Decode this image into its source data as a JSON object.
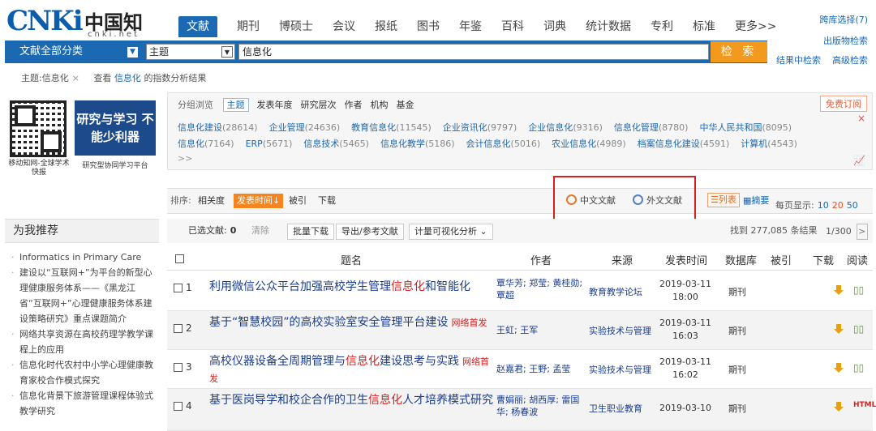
{
  "logo": {
    "cn": "CNKi",
    "zh": "中国知网",
    "sub": "cnki.net"
  },
  "top_nav": {
    "tabs": [
      "文献",
      "期刊",
      "博硕士",
      "会议",
      "报纸",
      "图书",
      "年鉴",
      "百科",
      "词典",
      "统计数据",
      "专利",
      "标准",
      "更多>>"
    ],
    "active": 0
  },
  "right_links": {
    "cross_library": "跨库选择(7)",
    "publication_search": "出版物检索",
    "result_search": "结果中检索",
    "advanced_search": "高级检索"
  },
  "search": {
    "category": "文献全部分类",
    "field": "主题",
    "query": "信息化",
    "button": "检 索"
  },
  "breadcrumb": {
    "filter": "主题:信息化",
    "remove": "×",
    "view_prefix": "查看",
    "view_term": "信息化",
    "view_suffix": "的指数分析结果"
  },
  "sidebar": {
    "qr_caption": "移动知网-全球学术快报",
    "promo_text": "研究与学习 不能少利器",
    "promo_caption": "研究型协同学习平台",
    "recommend_title": "为我推荐",
    "recommend_items": [
      "Informatics in Primary Care",
      "建设以“互联网+”为平台的新型心理健康服务体系——《黑龙江省“互联网+”心理健康服务体系建设策略研究》重点课题简介",
      "网络共享资源在高校药理学教学课程上的应用",
      "信息化时代农村中小学心理健康教育家校合作模式探究",
      "信息化背景下旅游管理课程体验式教学研究"
    ]
  },
  "group": {
    "label": "分组浏览",
    "tabs": [
      "主题",
      "发表年度",
      "研究层次",
      "作者",
      "机构",
      "基金"
    ],
    "subscribe": "免费订阅",
    "close": "×",
    "row1": [
      {
        "n": "信息化建设",
        "c": "(28614)"
      },
      {
        "n": "企业管理",
        "c": "(24636)"
      },
      {
        "n": "教育信息化",
        "c": "(11545)"
      },
      {
        "n": "企业资讯化",
        "c": "(9797)"
      },
      {
        "n": "企业信息化",
        "c": "(9316)"
      },
      {
        "n": "信息化管理",
        "c": "(8780)"
      },
      {
        "n": "中华人民共和国",
        "c": "(8095)"
      }
    ],
    "row2": [
      {
        "n": "信息化",
        "c": "(7164)"
      },
      {
        "n": "ERP",
        "c": "(5671)"
      },
      {
        "n": "信息技术",
        "c": "(5465)"
      },
      {
        "n": "信息化教学",
        "c": "(5186)"
      },
      {
        "n": "会计信息化",
        "c": "(5016)"
      },
      {
        "n": "农业信息化",
        "c": "(4989)"
      },
      {
        "n": "档案信息化建设",
        "c": "(4591)"
      },
      {
        "n": "计算机",
        "c": "(4543)"
      }
    ],
    "more": ">>"
  },
  "sort": {
    "label": "排序:",
    "options": [
      "相关度",
      "发表时间↓",
      "被引",
      "下载"
    ],
    "lang_zh": "中文文献",
    "lang_foreign": "外文文献",
    "view_list": "☰列表",
    "view_abstract": "▦摘要",
    "per_page_label": "每页显示:",
    "per_page": [
      "10",
      "20",
      "50"
    ]
  },
  "actions": {
    "selected_label": "已选文献:",
    "selected_count": "0",
    "clear": "清除",
    "batch_download": "批量下载",
    "export": "导出/参考文献",
    "viz": "计量可视化分析 ⌄",
    "found": "找到 277,085 条结果",
    "page": "1/300",
    "next": ">"
  },
  "table": {
    "headers": {
      "title": "题名",
      "author": "作者",
      "source": "来源",
      "date": "发表时间",
      "db": "数据库",
      "cited": "被引",
      "download": "下载",
      "read": "阅读"
    },
    "rows": [
      {
        "num": "1",
        "pre": "利用微信公众平台加强高校学生管理",
        "hl": "信息化",
        "post": "和智能化",
        "nf": "",
        "authors": "覃华芳; 郑莹; 黄桂勋; 覃超",
        "source": "教育教学论坛",
        "date": "2019-03-11",
        "time": "18:00",
        "db": "期刊",
        "read": "▯▯"
      },
      {
        "num": "2",
        "pre": "基于“智慧校园”的高校实验室安全管理平台建设",
        "hl": "",
        "post": "",
        "nf": "网络首发",
        "authors": "王虹; 王军",
        "source": "实验技术与管理",
        "date": "2019-03-11",
        "time": "16:03",
        "db": "期刊",
        "read": "▯▯"
      },
      {
        "num": "3",
        "pre": "高校仪器设备全周期管理与",
        "hl": "信息化",
        "post": "建设思考与实践",
        "nf": "网络首发",
        "authors": "赵嘉君; 王野; 孟莹",
        "source": "实验技术与管理",
        "date": "2019-03-11",
        "time": "16:02",
        "db": "期刊",
        "read": "▯▯"
      },
      {
        "num": "4",
        "pre": "基于医岗导学和校企合作的卫生",
        "hl": "信息化",
        "post": "人才培养模式研究",
        "nf": "",
        "authors": "曹娟丽; 胡西厚; 雷国华; 杨春波",
        "source": "卫生职业教育",
        "date": "2019-03-10",
        "time": "",
        "db": "期刊",
        "read": "HTML"
      }
    ]
  },
  "colors": {
    "brand": "#1b68b3",
    "accent": "#f39a1e",
    "highlight": "#d42222"
  }
}
